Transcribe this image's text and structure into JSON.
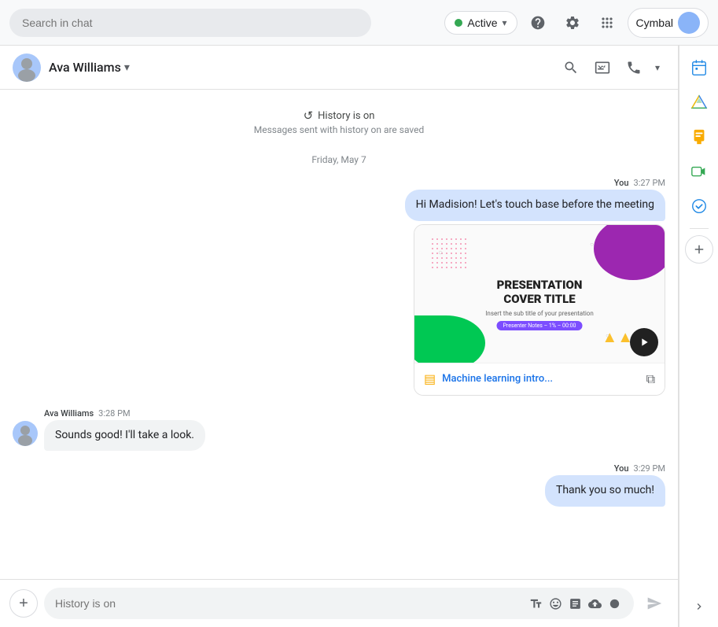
{
  "topbar": {
    "search_placeholder": "Search in chat",
    "active_label": "Active",
    "cymbal_label": "Cymbal"
  },
  "header": {
    "contact_name": "Ava Williams",
    "chevron": "▾"
  },
  "system": {
    "history_icon": "↺",
    "history_title": "History is on",
    "history_sub": "Messages sent with history on are saved",
    "date": "Friday, May 7"
  },
  "messages": [
    {
      "type": "outgoing",
      "sender": "You",
      "time": "3:27 PM",
      "text": "Hi Madision! Let's touch base before the meeting",
      "attachment": {
        "title_line1": "PRESENTATION",
        "title_line2": "COVER TITLE",
        "subtitle": "Insert the sub title of your presentation",
        "badge": "Presenter Notes – 1% – 00:00",
        "file_name": "Machine learning intro...",
        "has_play": true
      }
    },
    {
      "type": "incoming",
      "sender": "Ava Williams",
      "time": "3:28 PM",
      "text": "Sounds good! I'll take a look."
    },
    {
      "type": "outgoing",
      "sender": "You",
      "time": "3:29 PM",
      "text": "Thank you so much!"
    }
  ],
  "input": {
    "placeholder": "History is on"
  },
  "sidebar": {
    "apps": [
      {
        "id": "calendar",
        "label": "Calendar",
        "color": "#1e88e5"
      },
      {
        "id": "drive",
        "label": "Drive",
        "color": "#34a853"
      },
      {
        "id": "keep",
        "label": "Keep",
        "color": "#f9ab00"
      },
      {
        "id": "meet",
        "label": "Meet",
        "color": "#34a853"
      },
      {
        "id": "tasks",
        "label": "Tasks",
        "color": "#1e88e5"
      }
    ]
  }
}
